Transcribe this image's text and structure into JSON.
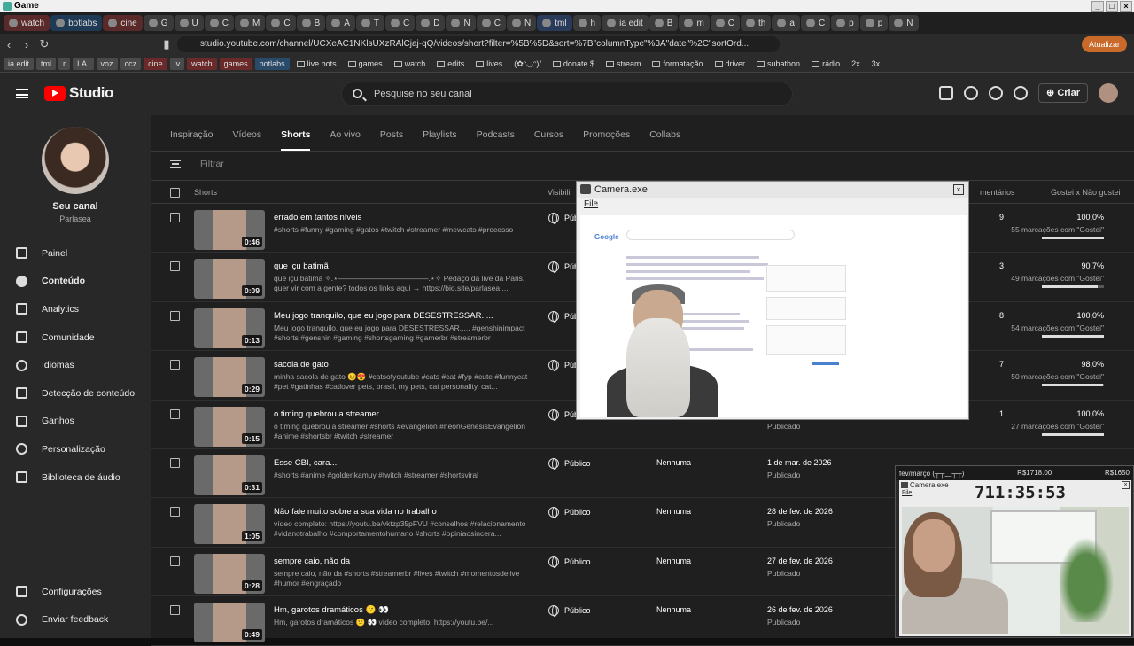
{
  "window": {
    "title": "Game"
  },
  "browser": {
    "tabs": [
      {
        "label": "watch",
        "style": "c1"
      },
      {
        "label": "botlabs",
        "style": "c2"
      },
      {
        "label": "cine",
        "style": "c1"
      },
      {
        "label": "G",
        "style": "g"
      },
      {
        "label": "U",
        "style": "g"
      },
      {
        "label": "C",
        "style": "g"
      },
      {
        "label": "M",
        "style": "g"
      },
      {
        "label": "C",
        "style": "g"
      },
      {
        "label": "B",
        "style": "g"
      },
      {
        "label": "A",
        "style": "g"
      },
      {
        "label": "T",
        "style": "g"
      },
      {
        "label": "C",
        "style": "g"
      },
      {
        "label": "D",
        "style": "g"
      },
      {
        "label": "N",
        "style": "g"
      },
      {
        "label": "C",
        "style": "g"
      },
      {
        "label": "N",
        "style": "g"
      },
      {
        "label": "tml",
        "style": "c3"
      },
      {
        "label": "h",
        "style": "g"
      },
      {
        "label": "ia edit",
        "style": "g"
      },
      {
        "label": "B",
        "style": "g"
      },
      {
        "label": "m",
        "style": "g"
      },
      {
        "label": "C",
        "style": "active"
      },
      {
        "label": "th",
        "style": "g"
      },
      {
        "label": "a",
        "style": "g"
      },
      {
        "label": "C",
        "style": "g"
      },
      {
        "label": "p",
        "style": "g"
      },
      {
        "label": "p",
        "style": "g"
      },
      {
        "label": "N",
        "style": "g"
      }
    ],
    "url": "studio.youtube.com/channel/UCXeAC1NKlsUXzRAlCjaj-qQ/videos/short?filter=%5B%5D&sort=%7B\"columnType\"%3A\"date\"%2C\"sortOrd...",
    "update_label": "Atualizar",
    "bookmarks": [
      {
        "label": "ia edit",
        "style": "tag"
      },
      {
        "label": "tml",
        "style": "tag"
      },
      {
        "label": "r",
        "style": "tag"
      },
      {
        "label": "I.A.",
        "style": "tag"
      },
      {
        "label": "voz",
        "style": "tag"
      },
      {
        "label": "ccz",
        "style": "tag"
      },
      {
        "label": "cine",
        "style": "r"
      },
      {
        "label": "lv",
        "style": "tag"
      },
      {
        "label": "watch",
        "style": "r"
      },
      {
        "label": "games",
        "style": "r"
      },
      {
        "label": "botlabs",
        "style": "b"
      },
      {
        "label": "live bots",
        "style": "fold"
      },
      {
        "label": "games",
        "style": "fold"
      },
      {
        "label": "watch",
        "style": "fold"
      },
      {
        "label": "edits",
        "style": "fold"
      },
      {
        "label": "lives",
        "style": "fold"
      },
      {
        "label": "(✿ᵔ◡ᵔ)/",
        "style": "plain"
      },
      {
        "label": "donate $",
        "style": "fold"
      },
      {
        "label": "stream",
        "style": "fold"
      },
      {
        "label": "formatação",
        "style": "fold"
      },
      {
        "label": "driver",
        "style": "fold"
      },
      {
        "label": "subathon",
        "style": "fold"
      },
      {
        "label": "rádio",
        "style": "fold"
      },
      {
        "label": "2x",
        "style": "plain"
      },
      {
        "label": "3x",
        "style": "plain"
      }
    ]
  },
  "studio": {
    "logo_text": "Studio",
    "search_placeholder": "Pesquise no seu canal",
    "create_label": "Criar",
    "channel": {
      "name": "Seu canal",
      "subtitle": "Parlasea"
    },
    "nav": [
      {
        "label": "Painel",
        "icon": "dashboard-icon"
      },
      {
        "label": "Conteúdo",
        "icon": "content-icon",
        "active": true
      },
      {
        "label": "Analytics",
        "icon": "analytics-icon"
      },
      {
        "label": "Comunidade",
        "icon": "community-icon"
      },
      {
        "label": "Idiomas",
        "icon": "languages-icon"
      },
      {
        "label": "Detecção de conteúdo",
        "icon": "content-detection-icon"
      },
      {
        "label": "Ganhos",
        "icon": "earnings-icon"
      },
      {
        "label": "Personalização",
        "icon": "customization-icon"
      },
      {
        "label": "Biblioteca de áudio",
        "icon": "audio-library-icon"
      }
    ],
    "nav_bottom": [
      {
        "label": "Configurações",
        "icon": "settings-icon"
      },
      {
        "label": "Enviar feedback",
        "icon": "feedback-icon"
      }
    ],
    "tabs": [
      "Inspiração",
      "Vídeos",
      "Shorts",
      "Ao vivo",
      "Posts",
      "Playlists",
      "Podcasts",
      "Cursos",
      "Promoções",
      "Collabs"
    ],
    "active_tab": "Shorts",
    "filter_placeholder": "Filtrar",
    "columns": {
      "shorts": "Shorts",
      "visibility": "Visibili",
      "comments": "mentários",
      "likes": "Gostei x Não gostei"
    },
    "rows": [
      {
        "title": "errado em tantos níveis",
        "desc": "#shorts #funny #gaming #gatos #twitch #streamer #mewcats #processo",
        "duration": "0:46",
        "visibility": "Públ",
        "restrictions": "",
        "date": "",
        "status": "",
        "comments": "9",
        "like_pct": "100,0%",
        "like_count": "55 marcações com \"Gostei\"",
        "like_ratio": 1.0
      },
      {
        "title": "que içu batimã",
        "desc": "que içu batimã ✧.⋆————————————.⋆✧ Pedaço da live da Paris, quer vir com a gente? todos os links aqui → https://bio.site/parlasea ...",
        "duration": "0:09",
        "visibility": "Públ",
        "restrictions": "",
        "date": "",
        "status": "",
        "comments": "3",
        "like_pct": "90,7%",
        "like_count": "49 marcações com \"Gostei\"",
        "like_ratio": 0.907
      },
      {
        "title": "Meu jogo tranquilo, que eu jogo para DESESTRESSAR.....",
        "desc": "Meu jogo tranquilo, que eu jogo para DESESTRESSAR..... #genshinimpact #shorts #genshin #gaming #shortsgaming #gamerbr #streamerbr",
        "duration": "0:13",
        "visibility": "Públ",
        "restrictions": "",
        "date": "",
        "status": "",
        "comments": "8",
        "like_pct": "100,0%",
        "like_count": "54 marcações com \"Gostei\"",
        "like_ratio": 1.0
      },
      {
        "title": "sacola de gato",
        "desc": "minha sacola de gato 😊😍 #catsofyoutube #cats #cat #fyp #cute #funnycat #pet #gatinhas #catlover pets, brasil, my pets, cat personality, cat...",
        "duration": "0:29",
        "visibility": "Públ",
        "restrictions": "",
        "date": "",
        "status": "",
        "comments": "7",
        "like_pct": "98,0%",
        "like_count": "50 marcações com \"Gostei\"",
        "like_ratio": 0.98
      },
      {
        "title": "o timing quebrou a streamer",
        "desc": "o timing quebrou a streamer #shorts #evangelion #neonGenesisEvangelion #anime #shortsbr #twitch #streamer",
        "duration": "0:15",
        "visibility": "Públ",
        "restrictions": "",
        "date": "2 de mar. de 2026",
        "status": "Publicado",
        "comments": "1",
        "like_pct": "100,0%",
        "like_count": "27 marcações com \"Gostei\"",
        "like_ratio": 1.0
      },
      {
        "title": "Esse CBI, cara....",
        "desc": "#shorts #anime #goldenkamuy #twitch #streamer #shortsviral",
        "duration": "0:31",
        "visibility": "Público",
        "restrictions": "Nenhuma",
        "date": "1 de mar. de 2026",
        "status": "Publicado",
        "comments": "",
        "like_pct": "",
        "like_count": "",
        "like_ratio": null
      },
      {
        "title": "Não fale muito sobre a sua vida no trabalho",
        "desc": "vídeo completo: https://youtu.be/vktzp35pFVU #conselhos #relacionamento #vidanotrabalho #comportamentohumano #shorts #opiniaosincera...",
        "duration": "1:05",
        "visibility": "Público",
        "restrictions": "Nenhuma",
        "date": "28 de fev. de 2026",
        "status": "Publicado",
        "comments": "",
        "like_pct": "",
        "like_count": "",
        "like_ratio": null
      },
      {
        "title": "sempre caio, não da",
        "desc": "sempre caio, não da #shorts #streamerbr #lives #twitch #momentosdelive #humor #engraçado",
        "duration": "0:28",
        "visibility": "Público",
        "restrictions": "Nenhuma",
        "date": "27 de fev. de 2026",
        "status": "Publicado",
        "comments": "",
        "like_pct": "",
        "like_count": "",
        "like_ratio": null
      },
      {
        "title": "Hm, garotos dramáticos 😕 👀",
        "desc": "Hm, garotos dramáticos 😕 👀 vídeo completo: https://youtu.be/...",
        "duration": "0:49",
        "visibility": "Público",
        "restrictions": "Nenhuma",
        "date": "26 de fev. de 2026",
        "status": "Publicado",
        "comments": "",
        "like_pct": "",
        "like_count": "",
        "like_ratio": null
      }
    ]
  },
  "overlay_camera": {
    "title": "Camera.exe",
    "menu": "File"
  },
  "overlay_small": {
    "left": "fev/março (┬┬﹏┬┬)",
    "mid": "R$1718.00",
    "right": "R$1650",
    "title": "Camera.exe",
    "clock": "711:35:53",
    "menu": "File"
  }
}
